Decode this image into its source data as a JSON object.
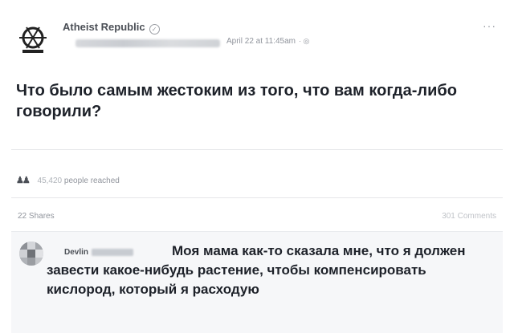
{
  "post": {
    "page_name": "Atheist Republic",
    "timestamp": "April 22 at 11:45am",
    "more_label": "···",
    "text": "Что было самым жестоким из того, что вам когда-либо говорили?"
  },
  "insights": {
    "reach_count": "45,420",
    "reach_label": "people reached"
  },
  "stats": {
    "shares": "22 Shares",
    "comments": "301 Comments"
  },
  "comment": {
    "author": "Devlin",
    "text": "Моя мама как-то сказала мне, что я должен завести какое-нибудь растение, чтобы компенсировать кислород, который я расходую"
  },
  "icons": {
    "verified": "verified-badge-icon",
    "globe": "globe-icon",
    "reach": "people-reach-icon",
    "logo": "atheist-republic-logo"
  }
}
